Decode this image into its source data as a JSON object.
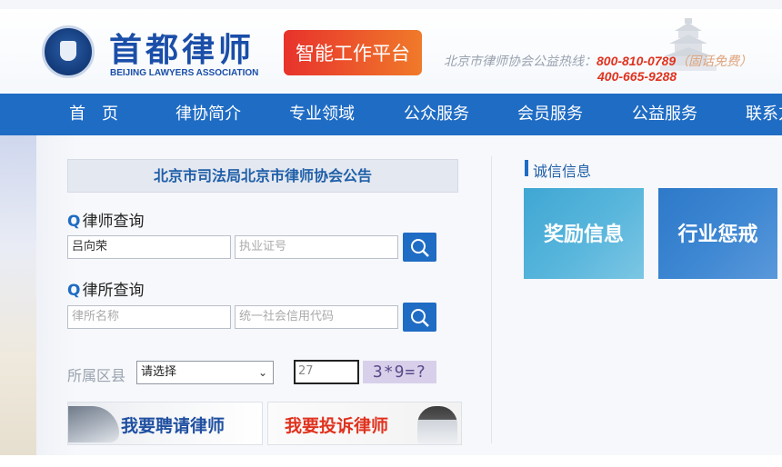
{
  "header": {
    "logo_cn": "首都律师",
    "logo_en": "BEIJING LAWYERS ASSOCIATION",
    "platform_button": "智能工作平台",
    "hotline_label": "北京市律师协会公益热线：",
    "hotline_number": "800-810-0789",
    "hotline_note": "（固话免费）",
    "hotline_number2": "400-665-9288"
  },
  "nav": {
    "items": [
      "首　页",
      "律协简介",
      "专业领域",
      "公众服务",
      "会员服务",
      "公益服务",
      "联系方"
    ]
  },
  "notice": {
    "title": "北京市司法局北京市律师协会公告"
  },
  "lawyer_search": {
    "title": "律师查询",
    "name_value": "吕向荣",
    "license_placeholder": "执业证号"
  },
  "firm_search": {
    "title": "律所查询",
    "name_placeholder": "律所名称",
    "credit_placeholder": "统一社会信用代码"
  },
  "district": {
    "label": "所属区县",
    "selected": "请选择",
    "captcha_value": "27",
    "captcha_question": "3*9=?"
  },
  "banners": {
    "hire": "我要聘请律师",
    "complain": "我要投诉律师"
  },
  "integrity": {
    "title": "诚信信息",
    "reward": "奖励信息",
    "discipline": "行业惩戒"
  },
  "colors": {
    "nav_bg": "#1f6cc4",
    "accent_red": "#e0321e",
    "brand_blue": "#1a4ea8"
  }
}
